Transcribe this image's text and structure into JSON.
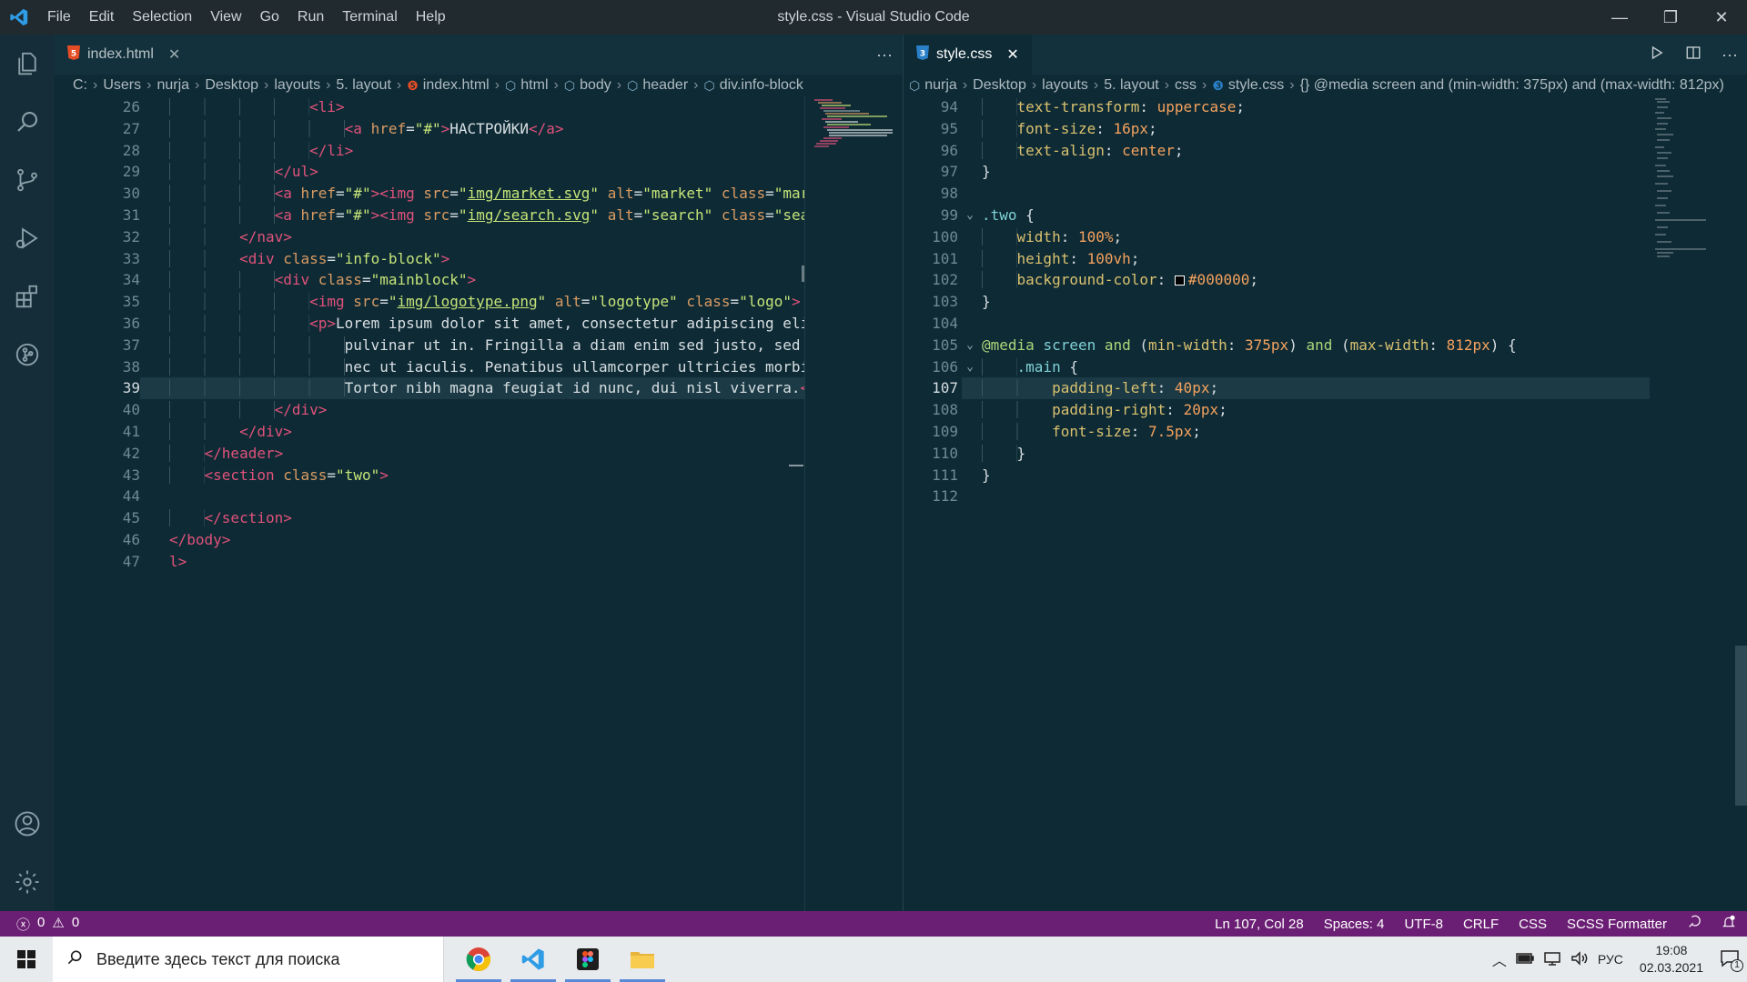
{
  "window": {
    "title": "style.css - Visual Studio Code",
    "menu": [
      "File",
      "Edit",
      "Selection",
      "View",
      "Go",
      "Run",
      "Terminal",
      "Help"
    ]
  },
  "activitybar": [
    "files-icon",
    "search-icon",
    "source-control-icon",
    "run-debug-icon",
    "extensions-icon",
    "git-lens-icon"
  ],
  "activitybar_bottom": [
    "account-icon",
    "settings-gear-icon"
  ],
  "left_editor": {
    "tab": "index.html",
    "more_actions": "···",
    "breadcrumbs": [
      "C:",
      "Users",
      "nurja",
      "Desktop",
      "layouts",
      "5. layout",
      "index.html",
      "html",
      "body",
      "header",
      "div.info-block"
    ],
    "lines": [
      {
        "n": "26",
        "indent": 4,
        "tokens": [
          [
            "t-tag",
            "<li>"
          ]
        ]
      },
      {
        "n": "27",
        "indent": 5,
        "tokens": [
          [
            "t-tag",
            "<a "
          ],
          [
            "t-attr",
            "href"
          ],
          [
            "t-punc",
            "="
          ],
          [
            "t-str",
            "\"#\""
          ],
          [
            "t-tag",
            ">"
          ],
          [
            "t-text",
            "НАСТРОЙКИ"
          ],
          [
            "t-tag",
            "</a>"
          ]
        ]
      },
      {
        "n": "28",
        "indent": 4,
        "tokens": [
          [
            "t-tag",
            "</li>"
          ]
        ]
      },
      {
        "n": "29",
        "indent": 3,
        "tokens": [
          [
            "t-tag",
            "</ul>"
          ]
        ]
      },
      {
        "n": "30",
        "indent": 3,
        "tokens": [
          [
            "t-tag",
            "<a "
          ],
          [
            "t-attr",
            "href"
          ],
          [
            "t-punc",
            "="
          ],
          [
            "t-str",
            "\"#\""
          ],
          [
            "t-tag",
            "><img "
          ],
          [
            "t-attr",
            "src"
          ],
          [
            "t-punc",
            "="
          ],
          [
            "t-str",
            "\""
          ],
          [
            "t-url",
            "img/market.svg"
          ],
          [
            "t-str",
            "\""
          ],
          [
            "t-attr",
            " alt"
          ],
          [
            "t-punc",
            "="
          ],
          [
            "t-str",
            "\"market\""
          ],
          [
            "t-attr",
            " class"
          ],
          [
            "t-punc",
            "="
          ],
          [
            "t-str",
            "\"market\""
          ],
          [
            "t-tag",
            ">"
          ]
        ]
      },
      {
        "n": "31",
        "indent": 3,
        "tokens": [
          [
            "t-tag",
            "<a "
          ],
          [
            "t-attr",
            "href"
          ],
          [
            "t-punc",
            "="
          ],
          [
            "t-str",
            "\"#\""
          ],
          [
            "t-tag",
            "><img "
          ],
          [
            "t-attr",
            "src"
          ],
          [
            "t-punc",
            "="
          ],
          [
            "t-str",
            "\""
          ],
          [
            "t-url",
            "img/search.svg"
          ],
          [
            "t-str",
            "\""
          ],
          [
            "t-attr",
            " alt"
          ],
          [
            "t-punc",
            "="
          ],
          [
            "t-str",
            "\"search\""
          ],
          [
            "t-attr",
            " class"
          ],
          [
            "t-punc",
            "="
          ],
          [
            "t-str",
            "\"search\""
          ],
          [
            "t-tag",
            ">"
          ]
        ]
      },
      {
        "n": "32",
        "indent": 2,
        "tokens": [
          [
            "t-tag",
            "</nav>"
          ]
        ]
      },
      {
        "n": "33",
        "indent": 2,
        "tokens": [
          [
            "t-tag",
            "<div "
          ],
          [
            "t-attr",
            "class"
          ],
          [
            "t-punc",
            "="
          ],
          [
            "t-str",
            "\"info-block\""
          ],
          [
            "t-tag",
            ">"
          ]
        ]
      },
      {
        "n": "34",
        "indent": 3,
        "tokens": [
          [
            "t-tag",
            "<div "
          ],
          [
            "t-attr",
            "class"
          ],
          [
            "t-punc",
            "="
          ],
          [
            "t-str",
            "\"mainblock\""
          ],
          [
            "t-tag",
            ">"
          ]
        ]
      },
      {
        "n": "35",
        "indent": 4,
        "tokens": [
          [
            "t-tag",
            "<img "
          ],
          [
            "t-attr",
            "src"
          ],
          [
            "t-punc",
            "="
          ],
          [
            "t-str",
            "\""
          ],
          [
            "t-url",
            "img/logotype.png"
          ],
          [
            "t-str",
            "\""
          ],
          [
            "t-attr",
            " alt"
          ],
          [
            "t-punc",
            "="
          ],
          [
            "t-str",
            "\"logotype\""
          ],
          [
            "t-attr",
            " class"
          ],
          [
            "t-punc",
            "="
          ],
          [
            "t-str",
            "\"logo\""
          ],
          [
            "t-tag",
            ">"
          ]
        ]
      },
      {
        "n": "36",
        "indent": 4,
        "tokens": [
          [
            "t-tag",
            "<p>"
          ],
          [
            "t-text",
            "Lorem ipsum dolor sit amet, consectetur adipiscing elit. Pu"
          ]
        ]
      },
      {
        "n": "37",
        "indent": 5,
        "tokens": [
          [
            "t-text",
            "pulvinar ut in. Fringilla a diam enim sed justo, sed iacul"
          ]
        ]
      },
      {
        "n": "38",
        "indent": 5,
        "tokens": [
          [
            "t-text",
            "nec ut iaculis. Penatibus ullamcorper ultricies morbi ipsu"
          ]
        ]
      },
      {
        "n": "39",
        "indent": 5,
        "current": true,
        "tokens": [
          [
            "t-text",
            "Tortor nibh magna feugiat id nunc, dui nisl viverra."
          ],
          [
            "t-tag",
            "</p>"
          ]
        ]
      },
      {
        "n": "40",
        "indent": 3,
        "tokens": [
          [
            "t-tag",
            "</div>"
          ]
        ]
      },
      {
        "n": "41",
        "indent": 2,
        "tokens": [
          [
            "t-tag",
            "</div>"
          ]
        ]
      },
      {
        "n": "42",
        "indent": 1,
        "tokens": [
          [
            "t-tag",
            "</header>"
          ]
        ]
      },
      {
        "n": "43",
        "indent": 1,
        "tokens": [
          [
            "t-tag",
            "<section "
          ],
          [
            "t-attr",
            "class"
          ],
          [
            "t-punc",
            "="
          ],
          [
            "t-str",
            "\"two\""
          ],
          [
            "t-tag",
            ">"
          ]
        ]
      },
      {
        "n": "44",
        "indent": 0,
        "tokens": []
      },
      {
        "n": "45",
        "indent": 1,
        "tokens": [
          [
            "t-tag",
            "</section>"
          ]
        ]
      },
      {
        "n": "46",
        "indent": 0,
        "tokens": [
          [
            "t-tag",
            "</body>"
          ]
        ]
      },
      {
        "n": "47",
        "indent": 0,
        "tokens": [
          [
            "t-tag",
            "l>"
          ]
        ]
      }
    ]
  },
  "right_editor": {
    "tab": "style.css",
    "breadcrumbs": [
      "nurja",
      "Desktop",
      "layouts",
      "5. layout",
      "css",
      "style.css",
      "{} @media screen and (min-width: 375px) and (max-width: 812px)"
    ],
    "lines": [
      {
        "n": "94",
        "indent": 1,
        "tokens": [
          [
            "t-prop",
            "text-transform"
          ],
          [
            "t-punc",
            ": "
          ],
          [
            "t-val",
            "uppercase"
          ],
          [
            "t-punc",
            ";"
          ]
        ]
      },
      {
        "n": "95",
        "indent": 1,
        "tokens": [
          [
            "t-prop",
            "font-size"
          ],
          [
            "t-punc",
            ": "
          ],
          [
            "t-num",
            "16px"
          ],
          [
            "t-punc",
            ";"
          ]
        ]
      },
      {
        "n": "96",
        "indent": 1,
        "tokens": [
          [
            "t-prop",
            "text-align"
          ],
          [
            "t-punc",
            ": "
          ],
          [
            "t-val",
            "center"
          ],
          [
            "t-punc",
            ";"
          ]
        ]
      },
      {
        "n": "97",
        "indent": 0,
        "tokens": [
          [
            "t-punc",
            "}"
          ]
        ]
      },
      {
        "n": "98",
        "indent": 0,
        "tokens": []
      },
      {
        "n": "99",
        "indent": 0,
        "fold": true,
        "tokens": [
          [
            "t-sel",
            ".two"
          ],
          [
            "t-punc",
            " {"
          ]
        ]
      },
      {
        "n": "100",
        "indent": 1,
        "tokens": [
          [
            "t-prop",
            "width"
          ],
          [
            "t-punc",
            ": "
          ],
          [
            "t-num",
            "100%"
          ],
          [
            "t-punc",
            ";"
          ]
        ]
      },
      {
        "n": "101",
        "indent": 1,
        "tokens": [
          [
            "t-prop",
            "height"
          ],
          [
            "t-punc",
            ": "
          ],
          [
            "t-num",
            "100vh"
          ],
          [
            "t-punc",
            ";"
          ]
        ]
      },
      {
        "n": "102",
        "indent": 1,
        "swatch": true,
        "tokens": [
          [
            "t-prop",
            "background-color"
          ],
          [
            "t-punc",
            ": "
          ],
          [
            "swatch",
            ""
          ],
          [
            "t-num",
            "#000000"
          ],
          [
            "t-punc",
            ";"
          ]
        ]
      },
      {
        "n": "103",
        "indent": 0,
        "tokens": [
          [
            "t-punc",
            "}"
          ]
        ]
      },
      {
        "n": "104",
        "indent": 0,
        "tokens": []
      },
      {
        "n": "105",
        "indent": 0,
        "fold": true,
        "tokens": [
          [
            "t-kw",
            "@media "
          ],
          [
            "t-sel",
            "screen "
          ],
          [
            "t-kw",
            "and "
          ],
          [
            "t-punc",
            "("
          ],
          [
            "t-prop",
            "min-width"
          ],
          [
            "t-punc",
            ": "
          ],
          [
            "t-num",
            "375px"
          ],
          [
            "t-punc",
            ") "
          ],
          [
            "t-kw",
            "and "
          ],
          [
            "t-punc",
            "("
          ],
          [
            "t-prop",
            "max-width"
          ],
          [
            "t-punc",
            ": "
          ],
          [
            "t-num",
            "812px"
          ],
          [
            "t-punc",
            ") {"
          ]
        ]
      },
      {
        "n": "106",
        "indent": 1,
        "fold": true,
        "tokens": [
          [
            "t-sel",
            ".main "
          ],
          [
            "t-punc",
            "{"
          ]
        ]
      },
      {
        "n": "107",
        "indent": 2,
        "current": true,
        "tokens": [
          [
            "t-prop",
            "padding-left"
          ],
          [
            "t-punc",
            ": "
          ],
          [
            "t-num",
            "40px"
          ],
          [
            "t-punc",
            ";"
          ]
        ]
      },
      {
        "n": "108",
        "indent": 2,
        "tokens": [
          [
            "t-prop",
            "padding-right"
          ],
          [
            "t-punc",
            ": "
          ],
          [
            "t-num",
            "20px"
          ],
          [
            "t-punc",
            ";"
          ]
        ]
      },
      {
        "n": "109",
        "indent": 2,
        "tokens": [
          [
            "t-prop",
            "font-size"
          ],
          [
            "t-punc",
            ": "
          ],
          [
            "t-num",
            "7.5px"
          ],
          [
            "t-punc",
            ";"
          ]
        ]
      },
      {
        "n": "110",
        "indent": 1,
        "tokens": [
          [
            "t-punc",
            "}"
          ]
        ]
      },
      {
        "n": "111",
        "indent": 0,
        "tokens": [
          [
            "t-punc",
            "}"
          ]
        ]
      },
      {
        "n": "112",
        "indent": 0,
        "tokens": []
      }
    ]
  },
  "statusbar": {
    "errors": "0",
    "warnings": "0",
    "position": "Ln 107, Col 28",
    "spaces": "Spaces: 4",
    "encoding": "UTF-8",
    "eol": "CRLF",
    "language": "CSS",
    "formatter": "SCSS Formatter"
  },
  "taskbar": {
    "search_placeholder": "Введите здесь текст для поиска",
    "apps": [
      "chrome-icon",
      "vscode-icon",
      "figma-icon",
      "explorer-icon"
    ],
    "lang": "РУС",
    "time": "19:08",
    "date": "02.03.2021",
    "notifications": "1"
  },
  "colors": {
    "statusbar": "#6b1f74",
    "editor_bg": "#0e2a35",
    "accent": "#5a8ad6"
  }
}
